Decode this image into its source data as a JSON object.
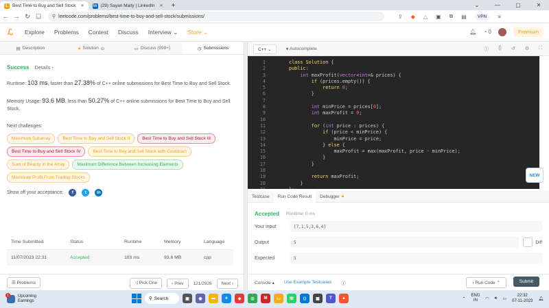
{
  "browser": {
    "tabs": [
      {
        "title": "Best Time to Buy and Sell Stock",
        "active": true,
        "favicon": "leetcode-icon"
      },
      {
        "title": "(29) Sayan Maity | LinkedIn",
        "active": false,
        "favicon": "linkedin-icon"
      }
    ],
    "url": "leetcode.com/problems/best-time-to-buy-and-sell-stock/submissions/",
    "vpn_label": "VPN"
  },
  "header": {
    "nav": [
      "Explore",
      "Problems",
      "Contest",
      "Discuss",
      "Interview",
      "Store"
    ],
    "notif_count": "0",
    "premium_label": "Premium"
  },
  "left_tabs": [
    "Description",
    "Solution",
    "Discuss (999+)",
    "Submissions"
  ],
  "result": {
    "status": "Success",
    "details_label": "Details",
    "runtime_prefix": "Runtime:",
    "runtime_value": "103 ms",
    "runtime_mid": ", faster than",
    "runtime_pct": "27.38%",
    "runtime_suffix": "of C++ online submissions for Best Time to Buy and Sell Stock.",
    "memory_prefix": "Memory Usage:",
    "memory_value": "93.6 MB",
    "memory_mid": ", less than",
    "memory_pct": "50.27%",
    "memory_suffix": "of C++ online submissions for Best Time to Buy and Sell Stock."
  },
  "next_challenges_title": "Next challenges:",
  "challenges": [
    {
      "label": "Maximum Subarray",
      "level": "medium"
    },
    {
      "label": "Best Time to Buy and Sell Stock II",
      "level": "medium"
    },
    {
      "label": "Best Time to Buy and Sell Stock III",
      "level": "hard"
    },
    {
      "label": "Best Time to Buy and Sell Stock IV",
      "level": "hard"
    },
    {
      "label": "Best Time to Buy and Sell Stock with Cooldown",
      "level": "medium"
    },
    {
      "label": "Sum of Beauty in the Array",
      "level": "medium"
    },
    {
      "label": "Maximum Difference Between Increasing Elements",
      "level": "easy"
    },
    {
      "label": "Maximum Profit From Trading Stocks",
      "level": "medium"
    }
  ],
  "share_label": "Show off your acceptance:",
  "submissions": {
    "headers": [
      "Time Submitted",
      "Status",
      "Runtime",
      "Memory",
      "Language"
    ],
    "rows": [
      [
        "11/07/2023 22:31",
        "Accepted",
        "103 ms",
        "93.6 MB",
        "cpp"
      ]
    ]
  },
  "left_bottom": {
    "problems_label": "Problems",
    "pick_one_label": "Pick One",
    "prev_label": "Prev",
    "page": "121/2926",
    "next_label": "Next"
  },
  "editor": {
    "language": "C++",
    "autocomplete_label": "Autocomplete",
    "lines": [
      "class Solution {",
      "public:",
      "    int maxProfit(vector<int>& prices) {",
      "        if (prices.empty()) {",
      "            return 0;",
      "        }",
      "",
      "        int minPrice = prices[0];",
      "        int maxProfit = 0;",
      "",
      "        for (int price : prices) {",
      "            if (price < minPrice) {",
      "                minPrice = price;",
      "            } else {",
      "                maxProfit = max(maxProfit, price - minPrice);",
      "            }",
      "        }",
      "",
      "        return maxProfit;",
      "    }",
      "};"
    ],
    "new_badge": "NEW"
  },
  "result_panel": {
    "tabs": [
      "Testcase",
      "Run Code Result",
      "Debugger"
    ],
    "status": "Accepted",
    "runtime": "Runtime: 0 ms",
    "your_input_label": "Your input",
    "your_input": "[7,1,5,3,6,4]",
    "output_label": "Output",
    "output": "5",
    "expected_label": "Expected",
    "expected": "5",
    "diff_label": "Diff"
  },
  "right_bottom": {
    "console_label": "Console",
    "use_example_label": "Use Example Testcases",
    "run_label": "Run Code",
    "submit_label": "Submit"
  },
  "taskbar": {
    "weather_title": "Upcoming",
    "weather_sub": "Earnings",
    "weather_badge": "1",
    "search_label": "Search",
    "lang_top": "ENG",
    "lang_bottom": "IN",
    "time": "22:32",
    "date": "07-11-2023"
  },
  "colors": {
    "success": "#2db55d",
    "brand": "#f89f1b",
    "hard": "#a8203a",
    "editor_bg": "#262626"
  }
}
